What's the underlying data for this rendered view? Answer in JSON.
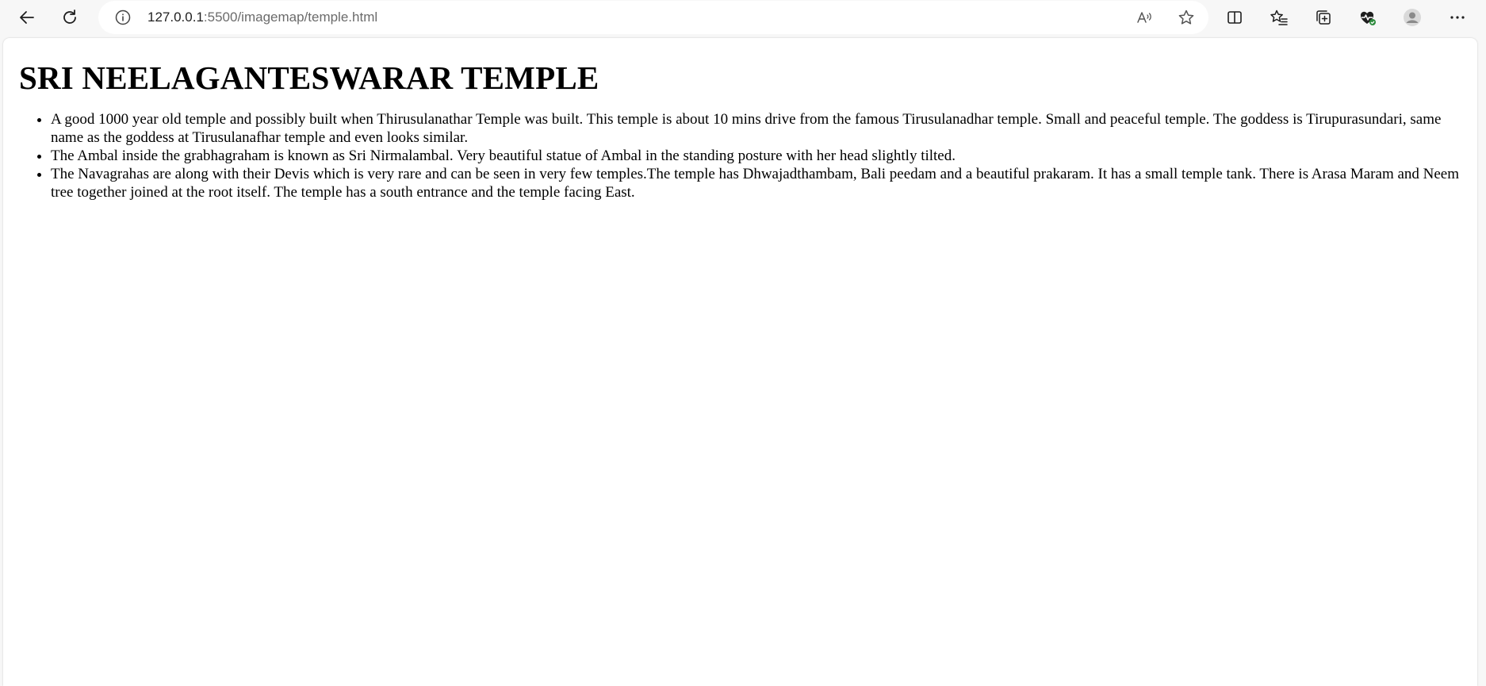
{
  "browser": {
    "url_host": "127.0.0.1",
    "url_path": ":5500/imagemap/temple.html",
    "icons": {
      "back": "back-arrow-icon",
      "refresh": "refresh-icon",
      "info": "info-icon",
      "read_aloud": "read-aloud-icon",
      "favorite": "star-icon",
      "split_screen": "split-screen-icon",
      "favorites": "favorites-list-icon",
      "collections": "collections-icon",
      "health": "browser-essentials-icon",
      "profile": "profile-icon",
      "more": "more-icon"
    }
  },
  "page": {
    "heading": "SRI NEELAGANTESWARAR TEMPLE",
    "items": [
      "A good 1000 year old temple and possibly built when Thirusulanathar Temple was built. This temple is about 10 mins drive from the famous Tirusulanadhar temple. Small and peaceful temple. The goddess is Tirupurasundari, same name as the goddess at Tirusulanafhar temple and even looks similar.",
      "The Ambal inside the grabhagraham is known as Sri Nirmalambal. Very beautiful statue of Ambal in the standing posture with her head slightly tilted.",
      "The Navagrahas are along with their Devis which is very rare and can be seen in very few temples.The temple has Dhwajadthambam, Bali peedam and a beautiful prakaram. It has a small temple tank. There is Arasa Maram and Neem tree together joined at the root itself. The temple has a south entrance and the temple facing East."
    ]
  }
}
